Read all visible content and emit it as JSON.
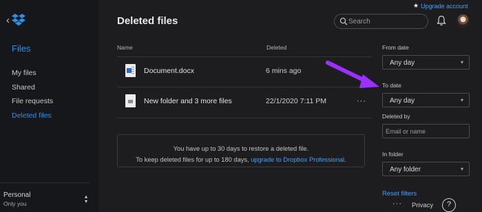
{
  "header": {
    "upgrade_label": "Upgrade account",
    "search_placeholder": "Search",
    "accent": "#2d8fe6"
  },
  "sidebar": {
    "title": "Files",
    "items": [
      {
        "label": "My files"
      },
      {
        "label": "Shared"
      },
      {
        "label": "File requests"
      },
      {
        "label": "Deleted files",
        "active": true
      }
    ],
    "account": {
      "name": "Personal",
      "sub": "Only you"
    }
  },
  "main": {
    "title": "Deleted files",
    "columns": {
      "name": "Name",
      "deleted": "Deleted"
    },
    "rows": [
      {
        "name": "Document.docx",
        "deleted": "6 mins ago",
        "icon": "word-doc-icon"
      },
      {
        "name": "New folder and 3 more files",
        "deleted": "22/1/2020 7:11 PM",
        "icon": "folder-file-icon"
      }
    ],
    "more_label": "···",
    "notice": {
      "line1": "You have up to 30 days to restore a deleted file.",
      "line2_prefix": "To keep deleted files for up to 180 days, ",
      "link": "upgrade to Dropbox Professional",
      "line2_suffix": "."
    }
  },
  "filters": {
    "from_label": "From date",
    "from_value": "Any day",
    "to_label": "To date",
    "to_value": "Any day",
    "deleted_by_label": "Deleted by",
    "deleted_by_placeholder": "Email or name",
    "folder_label": "In folder",
    "folder_value": "Any folder",
    "reset": "Reset filters"
  },
  "footer": {
    "more": "···",
    "privacy": "Privacy",
    "help": "?"
  },
  "annotation": {
    "arrow_color": "#9b30ff"
  }
}
